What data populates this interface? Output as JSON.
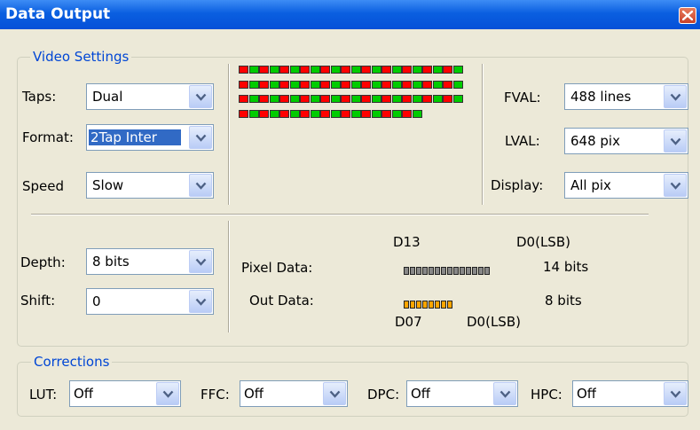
{
  "window": {
    "title": "Data Output"
  },
  "video": {
    "group_label": "Video Settings",
    "taps": {
      "label": "Taps:",
      "value": "Dual"
    },
    "format": {
      "label": "Format:",
      "value": "2Tap Inter"
    },
    "speed": {
      "label": "Speed",
      "value": "Slow"
    },
    "fval": {
      "label": "FVAL:",
      "value": "488 lines"
    },
    "lval": {
      "label": "LVAL:",
      "value": "648 pix"
    },
    "display": {
      "label": "Display:",
      "value": "All pix"
    },
    "depth": {
      "label": "Depth:",
      "value": "8 bits"
    },
    "shift": {
      "label": "Shift:",
      "value": "0"
    }
  },
  "led_pattern": [
    "RGRGRGRGRGRGRGRGRGRGRG",
    "RGRGRGRGRGRGRGRGRGRGRG",
    "RGRGRGRGRGRGRGRGRGRGRG",
    "RGRGRGRGRGRGRGRGRG"
  ],
  "bit_diagram": {
    "top_msb": "D13",
    "top_lsb": "D0(LSB)",
    "pixel_label": "Pixel Data:",
    "pixel_bits": 14,
    "pixel_bits_text": "14 bits",
    "out_label": "Out Data:",
    "out_bits": 8,
    "out_bits_text": "8 bits",
    "bottom_msb": "D07",
    "bottom_lsb": "D0(LSB)"
  },
  "corrections": {
    "group_label": "Corrections",
    "lut": {
      "label": "LUT:",
      "value": "Off"
    },
    "ffc": {
      "label": "FFC:",
      "value": "Off"
    },
    "dpc": {
      "label": "DPC:",
      "value": "Off"
    },
    "hpc": {
      "label": "HPC:",
      "value": "Off"
    }
  },
  "colors": {
    "led_red": "#ff0000",
    "led_green": "#00cc00",
    "pixel_bit": "#888888",
    "out_bit": "#ffa500"
  }
}
